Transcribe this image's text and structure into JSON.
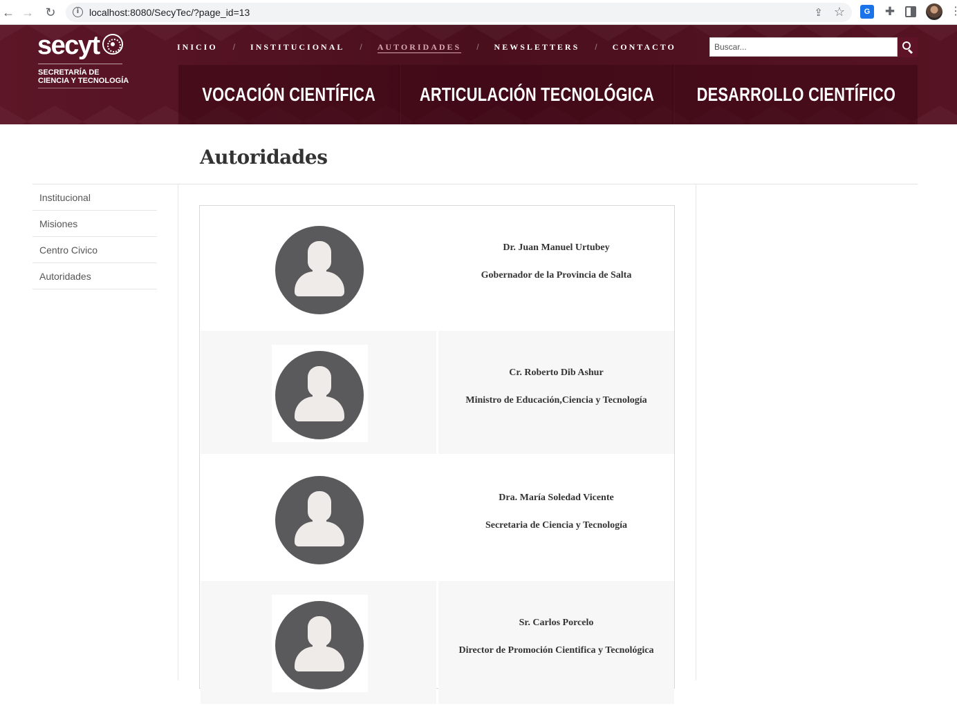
{
  "browser": {
    "url": "localhost:8080/SecyTec/?page_id=13"
  },
  "logo": {
    "word": "secyt",
    "subtitle_line1": "SECRETARÍA DE",
    "subtitle_line2": "CIENCIA Y TECNOLOGÍA"
  },
  "topnav": {
    "items": [
      "INICIO",
      "INSTITUCIONAL",
      "AUTORIDADES",
      "NEWSLETTERS",
      "CONTACTO"
    ],
    "separator": "/",
    "active": "AUTORIDADES"
  },
  "search": {
    "placeholder": "Buscar..."
  },
  "categories": [
    "VOCACIÓN CIENTÍFICA",
    "ARTICULACIÓN TECNOLÓGICA",
    "DESARROLLO CIENTÍFICO"
  ],
  "page": {
    "title": "Autoridades"
  },
  "sidebar": {
    "items": [
      "Institucional",
      "Misiones",
      "Centro Civico",
      "Autoridades"
    ]
  },
  "authorities": [
    {
      "name": "Dr. Juan Manuel Urtubey",
      "role": "Gobernador de la Provincia de Salta"
    },
    {
      "name": "Cr. Roberto Dib Ashur",
      "role": "Ministro de Educación,Ciencia y Tecnología"
    },
    {
      "name": "Dra. María Soledad Vicente",
      "role": "Secretaria de Ciencia y Tecnología"
    },
    {
      "name": "Sr. Carlos Porcelo",
      "role": "Director de Promoción Cientifica y Tecnológica"
    }
  ],
  "colors": {
    "brand": "#4a0f1d",
    "active_nav": "#d9a6b3"
  },
  "icons": {
    "back": "back-arrow-icon",
    "forward": "forward-arrow-icon",
    "reload": "reload-icon",
    "search": "search-icon",
    "avatar": "user-placeholder-icon"
  }
}
